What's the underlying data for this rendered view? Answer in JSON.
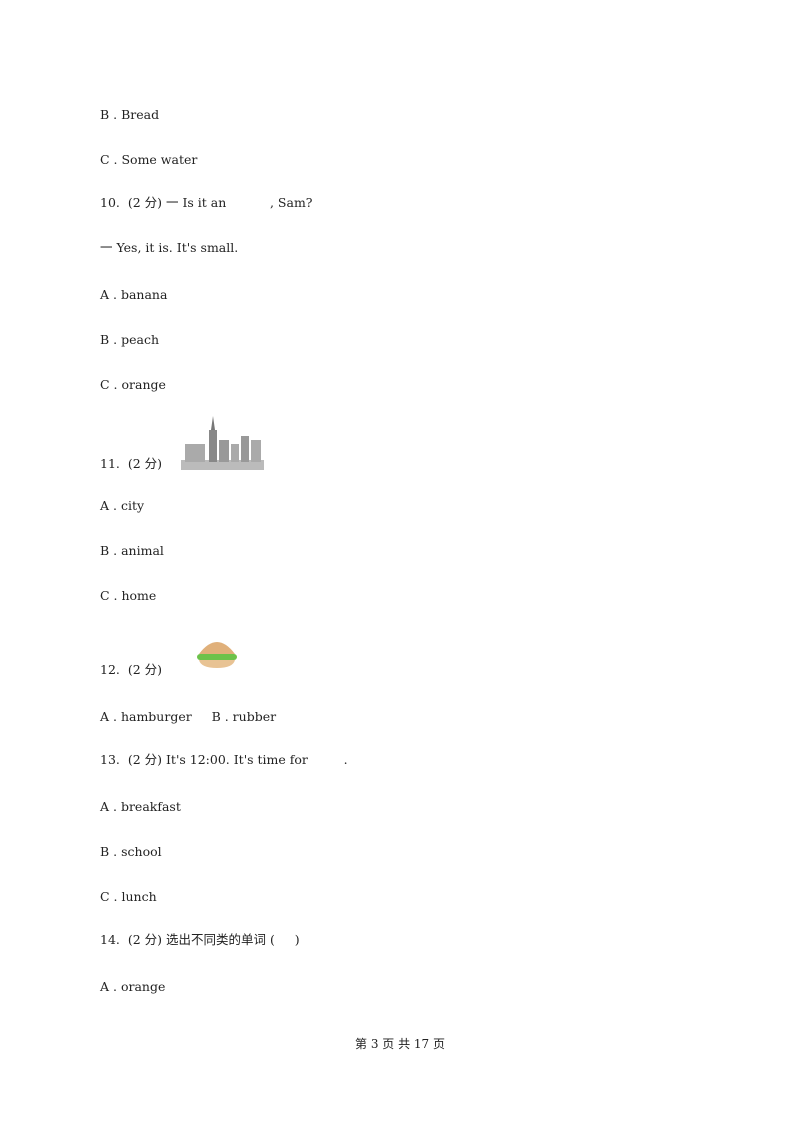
{
  "lines": [
    {
      "text": "B . Bread"
    },
    {
      "text": "C . Some water"
    },
    {
      "text": "10.  (2 分) 一 Is it an           , Sam?"
    },
    {
      "text": "一 Yes, it is. It's small."
    },
    {
      "text": "A . banana"
    },
    {
      "text": "B . peach"
    },
    {
      "text": "C . orange"
    },
    {
      "text": "11.  (2 分)"
    },
    {
      "text": "A . city"
    },
    {
      "text": "B . animal"
    },
    {
      "text": "C . home"
    },
    {
      "text": "12.  (2 分)"
    },
    {
      "text": "A . hamburger     B . rubber"
    },
    {
      "text": "13.  (2 分) It's 12:00. It's time for         ."
    },
    {
      "text": "A . breakfast"
    },
    {
      "text": "B . school"
    },
    {
      "text": "C . lunch"
    },
    {
      "text": "14.  (2 分) 选出不同类的单词 (     )"
    },
    {
      "text": "A . orange"
    }
  ],
  "footer": "第 3 页 共 17 页"
}
